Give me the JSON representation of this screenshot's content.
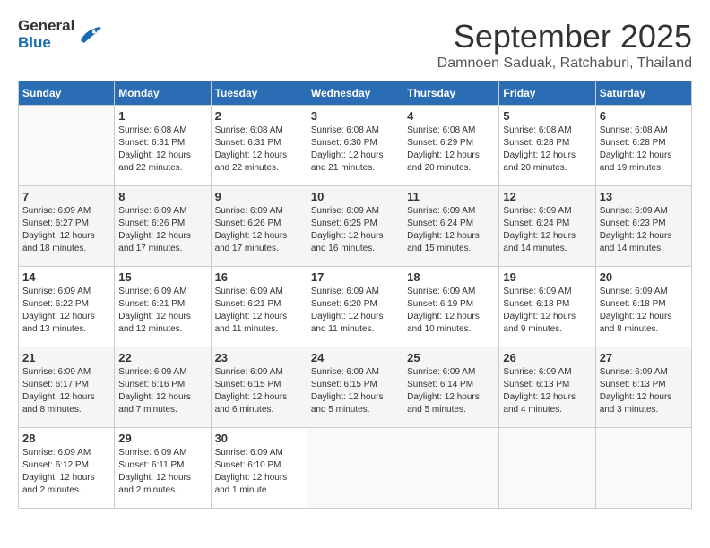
{
  "logo": {
    "general": "General",
    "blue": "Blue"
  },
  "header": {
    "month": "September 2025",
    "location": "Damnoen Saduak, Ratchaburi, Thailand"
  },
  "columns": [
    "Sunday",
    "Monday",
    "Tuesday",
    "Wednesday",
    "Thursday",
    "Friday",
    "Saturday"
  ],
  "weeks": [
    [
      {
        "day": "",
        "info": ""
      },
      {
        "day": "1",
        "info": "Sunrise: 6:08 AM\nSunset: 6:31 PM\nDaylight: 12 hours\nand 22 minutes."
      },
      {
        "day": "2",
        "info": "Sunrise: 6:08 AM\nSunset: 6:31 PM\nDaylight: 12 hours\nand 22 minutes."
      },
      {
        "day": "3",
        "info": "Sunrise: 6:08 AM\nSunset: 6:30 PM\nDaylight: 12 hours\nand 21 minutes."
      },
      {
        "day": "4",
        "info": "Sunrise: 6:08 AM\nSunset: 6:29 PM\nDaylight: 12 hours\nand 20 minutes."
      },
      {
        "day": "5",
        "info": "Sunrise: 6:08 AM\nSunset: 6:28 PM\nDaylight: 12 hours\nand 20 minutes."
      },
      {
        "day": "6",
        "info": "Sunrise: 6:08 AM\nSunset: 6:28 PM\nDaylight: 12 hours\nand 19 minutes."
      }
    ],
    [
      {
        "day": "7",
        "info": "Sunrise: 6:09 AM\nSunset: 6:27 PM\nDaylight: 12 hours\nand 18 minutes."
      },
      {
        "day": "8",
        "info": "Sunrise: 6:09 AM\nSunset: 6:26 PM\nDaylight: 12 hours\nand 17 minutes."
      },
      {
        "day": "9",
        "info": "Sunrise: 6:09 AM\nSunset: 6:26 PM\nDaylight: 12 hours\nand 17 minutes."
      },
      {
        "day": "10",
        "info": "Sunrise: 6:09 AM\nSunset: 6:25 PM\nDaylight: 12 hours\nand 16 minutes."
      },
      {
        "day": "11",
        "info": "Sunrise: 6:09 AM\nSunset: 6:24 PM\nDaylight: 12 hours\nand 15 minutes."
      },
      {
        "day": "12",
        "info": "Sunrise: 6:09 AM\nSunset: 6:24 PM\nDaylight: 12 hours\nand 14 minutes."
      },
      {
        "day": "13",
        "info": "Sunrise: 6:09 AM\nSunset: 6:23 PM\nDaylight: 12 hours\nand 14 minutes."
      }
    ],
    [
      {
        "day": "14",
        "info": "Sunrise: 6:09 AM\nSunset: 6:22 PM\nDaylight: 12 hours\nand 13 minutes."
      },
      {
        "day": "15",
        "info": "Sunrise: 6:09 AM\nSunset: 6:21 PM\nDaylight: 12 hours\nand 12 minutes."
      },
      {
        "day": "16",
        "info": "Sunrise: 6:09 AM\nSunset: 6:21 PM\nDaylight: 12 hours\nand 11 minutes."
      },
      {
        "day": "17",
        "info": "Sunrise: 6:09 AM\nSunset: 6:20 PM\nDaylight: 12 hours\nand 11 minutes."
      },
      {
        "day": "18",
        "info": "Sunrise: 6:09 AM\nSunset: 6:19 PM\nDaylight: 12 hours\nand 10 minutes."
      },
      {
        "day": "19",
        "info": "Sunrise: 6:09 AM\nSunset: 6:18 PM\nDaylight: 12 hours\nand 9 minutes."
      },
      {
        "day": "20",
        "info": "Sunrise: 6:09 AM\nSunset: 6:18 PM\nDaylight: 12 hours\nand 8 minutes."
      }
    ],
    [
      {
        "day": "21",
        "info": "Sunrise: 6:09 AM\nSunset: 6:17 PM\nDaylight: 12 hours\nand 8 minutes."
      },
      {
        "day": "22",
        "info": "Sunrise: 6:09 AM\nSunset: 6:16 PM\nDaylight: 12 hours\nand 7 minutes."
      },
      {
        "day": "23",
        "info": "Sunrise: 6:09 AM\nSunset: 6:15 PM\nDaylight: 12 hours\nand 6 minutes."
      },
      {
        "day": "24",
        "info": "Sunrise: 6:09 AM\nSunset: 6:15 PM\nDaylight: 12 hours\nand 5 minutes."
      },
      {
        "day": "25",
        "info": "Sunrise: 6:09 AM\nSunset: 6:14 PM\nDaylight: 12 hours\nand 5 minutes."
      },
      {
        "day": "26",
        "info": "Sunrise: 6:09 AM\nSunset: 6:13 PM\nDaylight: 12 hours\nand 4 minutes."
      },
      {
        "day": "27",
        "info": "Sunrise: 6:09 AM\nSunset: 6:13 PM\nDaylight: 12 hours\nand 3 minutes."
      }
    ],
    [
      {
        "day": "28",
        "info": "Sunrise: 6:09 AM\nSunset: 6:12 PM\nDaylight: 12 hours\nand 2 minutes."
      },
      {
        "day": "29",
        "info": "Sunrise: 6:09 AM\nSunset: 6:11 PM\nDaylight: 12 hours\nand 2 minutes."
      },
      {
        "day": "30",
        "info": "Sunrise: 6:09 AM\nSunset: 6:10 PM\nDaylight: 12 hours\nand 1 minute."
      },
      {
        "day": "",
        "info": ""
      },
      {
        "day": "",
        "info": ""
      },
      {
        "day": "",
        "info": ""
      },
      {
        "day": "",
        "info": ""
      }
    ]
  ]
}
